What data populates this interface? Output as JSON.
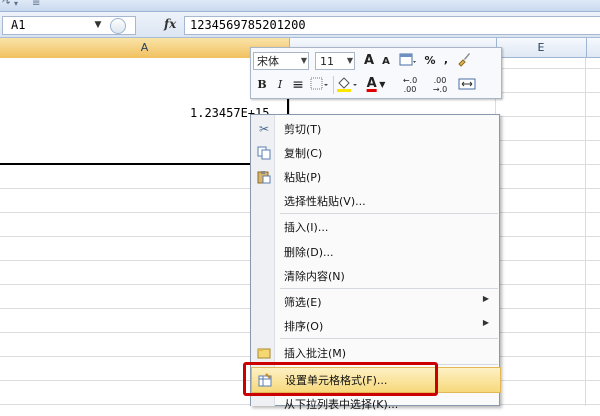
{
  "quick_access": {
    "redo_symbol": "↷",
    "dropdown_symbol": "▾"
  },
  "formula_bar": {
    "name_box": "A1",
    "fx_label": "fx",
    "content": "1234569785201200"
  },
  "columns": {
    "a": "A",
    "e": "E"
  },
  "cell_a1_display": "1.23457E+15",
  "mini_toolbar": {
    "font_name": "宋体",
    "font_size": "11",
    "grow_font": "A",
    "shrink_font": "A",
    "percent": "%",
    "comma": ",",
    "bold": "B",
    "italic": "I",
    "font_color_letter": "A",
    "increase_decimal": "←.0 .00",
    "decrease_decimal": ".00 →.0"
  },
  "context_menu": {
    "items": [
      {
        "label": "剪切(T)",
        "icon": "scissors-icon"
      },
      {
        "label": "复制(C)",
        "icon": "copy-icon"
      },
      {
        "label": "粘贴(P)",
        "icon": "paste-icon"
      },
      {
        "label": "选择性粘贴(V)..."
      },
      {
        "label": "插入(I)..."
      },
      {
        "label": "删除(D)..."
      },
      {
        "label": "清除内容(N)"
      },
      {
        "label": "筛选(E)",
        "has_submenu": true
      },
      {
        "label": "排序(O)",
        "has_submenu": true
      },
      {
        "label": "插入批注(M)",
        "icon": "comment-icon"
      },
      {
        "label": "设置单元格格式(F)...",
        "icon": "format-cells-icon",
        "highlighted": true
      },
      {
        "label": "从下拉列表中选择(K)..."
      }
    ]
  },
  "colors": {
    "highlight_border": "#cc0000",
    "selected_column": "#f1c15f"
  }
}
